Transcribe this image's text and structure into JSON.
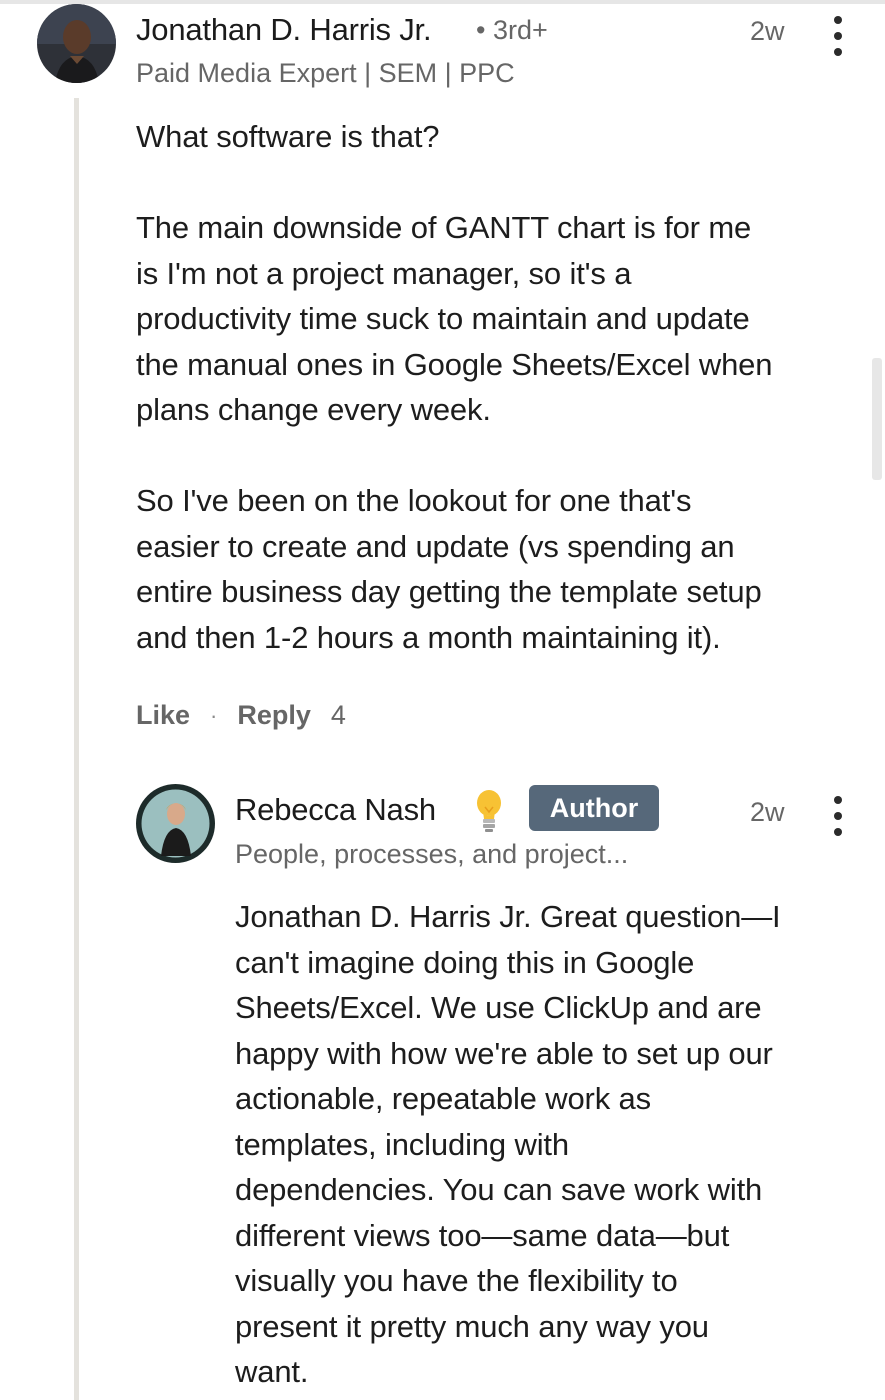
{
  "colors": {
    "background": "#ffffff",
    "text_primary": "#1d1d1d",
    "text_secondary": "#666666",
    "thread_line": "#e4e2dd",
    "author_badge_bg": "#56687a",
    "author_badge_text": "#ffffff"
  },
  "comment": {
    "author_name": "Jonathan D. Harris Jr.",
    "connection_degree": "• 3rd+",
    "headline": "Paid Media Expert | SEM | PPC",
    "time": "2w",
    "more_icon": "more-vertical-icon",
    "body_lines": [
      "What software is that?",
      "",
      "The main downside of GANTT chart is for me",
      "is I'm not a project manager, so it's a",
      "productivity time suck to maintain and update",
      "the manual ones in Google Sheets/Excel when",
      "plans change every week.",
      "",
      "So I've been on the lookout for one that's",
      "easier to create and update (vs spending an",
      "entire business day getting the template setup",
      "and then 1-2 hours a month maintaining it)."
    ],
    "actions": {
      "like": "Like",
      "separator": "·",
      "reply": "Reply",
      "reply_count": "4"
    }
  },
  "reply": {
    "author_name": "Rebecca Nash",
    "badge_icon": "lightbulb-icon",
    "badge_label": "Author",
    "headline": "People, processes, and project...",
    "time": "2w",
    "more_icon": "more-vertical-icon",
    "body_lines": [
      "Jonathan D. Harris Jr. Great question—I",
      "can't imagine doing this in Google",
      "Sheets/Excel. We use ClickUp and are",
      "happy with how we're able to set up our",
      "actionable, repeatable work as",
      "templates, including with",
      "dependencies. You can save work with",
      "different views too—same data—but",
      "visually you have the flexibility to",
      "present it pretty much any way you",
      "want."
    ]
  }
}
